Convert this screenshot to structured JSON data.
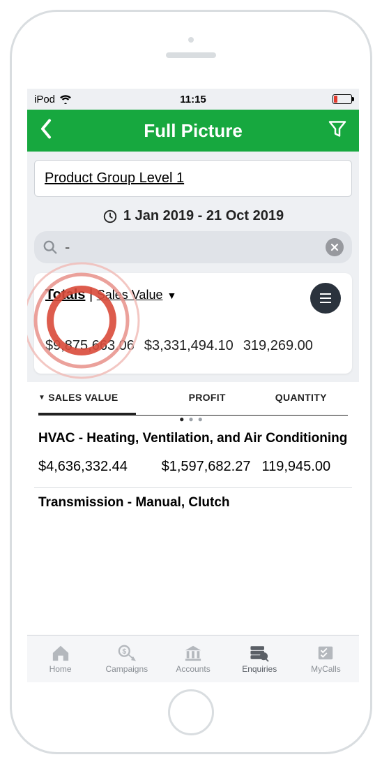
{
  "status": {
    "carrier": "iPod",
    "time": "11:15"
  },
  "header": {
    "title": "Full Picture"
  },
  "selector": {
    "label": "Product Group Level 1"
  },
  "date": {
    "range": "1 Jan 2019 - 21 Oct 2019"
  },
  "search": {
    "value": "-"
  },
  "totals": {
    "label_a": "Totals",
    "separator": " | ",
    "label_b": "Sales Value",
    "values": {
      "sales": "$9,875,663.06",
      "profit": "$3,331,494.10",
      "qty": "319,269.00"
    }
  },
  "table": {
    "columns": {
      "c1": "SALES VALUE",
      "c2": "PROFIT",
      "c3": "QUANTITY"
    },
    "rows": [
      {
        "title": "HVAC - Heating, Ventilation, and Air Conditioning",
        "sales": "$4,636,332.44",
        "profit": "$1,597,682.27",
        "qty": "119,945.00"
      },
      {
        "title": "Transmission - Manual, Clutch",
        "sales": "",
        "profit": "",
        "qty": ""
      }
    ]
  },
  "tabs": {
    "home": "Home",
    "campaigns": "Campaigns",
    "accounts": "Accounts",
    "enquiries": "Enquiries",
    "mycalls": "MyCalls"
  },
  "icons": {
    "back": "back-chevron",
    "filter": "funnel",
    "clock": "clock",
    "search": "magnifier",
    "clear": "x-circle",
    "menu": "hamburger"
  }
}
